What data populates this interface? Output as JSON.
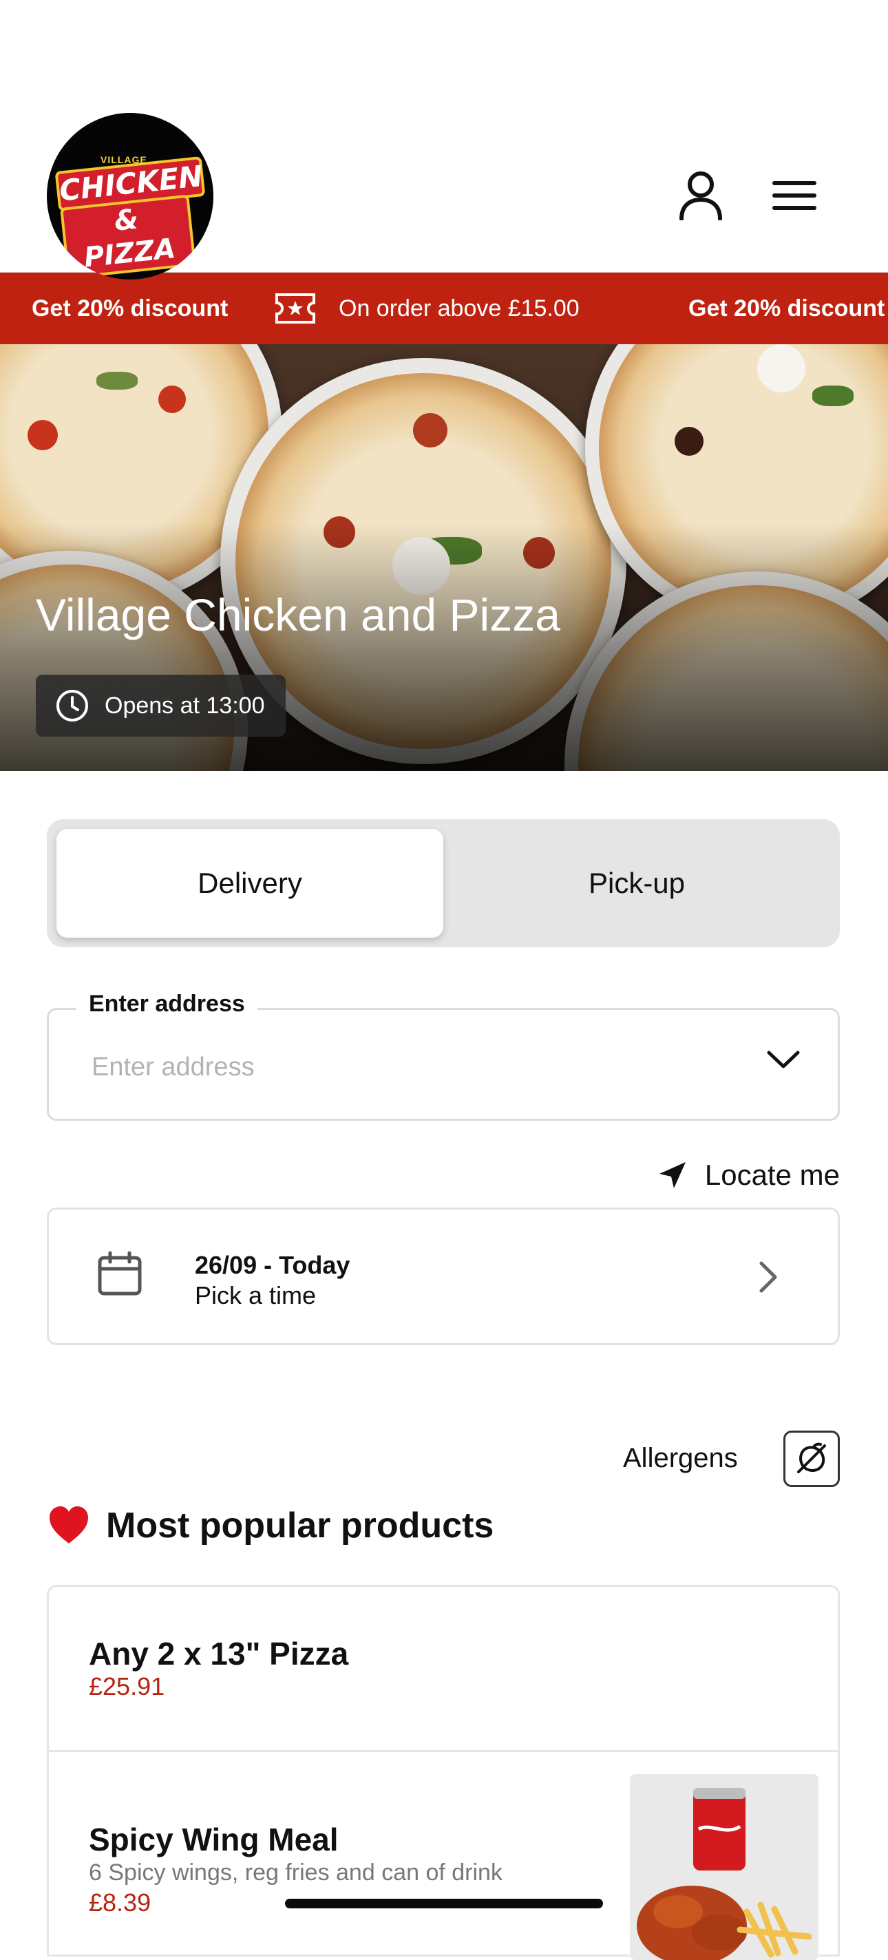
{
  "header": {
    "logo": {
      "line_small": "VILLAGE",
      "line1": "CHICKEN",
      "line2": "& PIZZA"
    }
  },
  "promo": {
    "headline": "Get 20% discount",
    "detail": "On order above £15.00",
    "headline_repeat": "Get 20% discount"
  },
  "hero": {
    "title": "Village Chicken and Pizza",
    "opens": "Opens at 13:00"
  },
  "order_mode": {
    "options": [
      "Delivery",
      "Pick-up"
    ],
    "selected": "Delivery"
  },
  "address": {
    "label": "Enter address",
    "placeholder": "Enter address",
    "value": ""
  },
  "locate_label": "Locate me",
  "schedule": {
    "date": "26/09 - Today",
    "time": "Pick a time"
  },
  "allergens_label": "Allergens",
  "popular": {
    "title": "Most popular products",
    "products": [
      {
        "name": "Any 2 x 13\" Pizza",
        "price": "£25.91"
      },
      {
        "name": "Spicy Wing Meal",
        "description": "6 Spicy wings, reg fries and can of drink",
        "price": "£8.39"
      }
    ]
  },
  "colors": {
    "brand_red": "#bf2211",
    "price_red": "#b8230f"
  }
}
